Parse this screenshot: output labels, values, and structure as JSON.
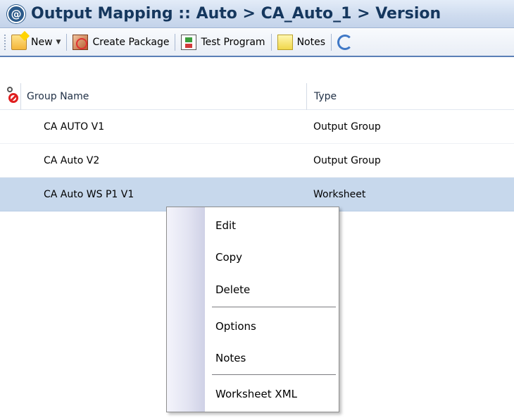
{
  "window": {
    "title": "Output Mapping :: Auto > CA_Auto_1 > Version",
    "title_icon": "circle-at-icon"
  },
  "toolbar": {
    "new_label": "New",
    "create_package_label": "Create Package",
    "test_program_label": "Test Program",
    "notes_label": "Notes"
  },
  "grid": {
    "columns": [
      "Group Name",
      "Type"
    ],
    "rows": [
      {
        "name": "CA AUTO V1",
        "type": "Output Group"
      },
      {
        "name": "CA Auto V2",
        "type": "Output Group"
      },
      {
        "name": "CA Auto WS P1 V1",
        "type": "Worksheet"
      }
    ],
    "selected_index": 2
  },
  "context_menu": {
    "items": [
      "Edit",
      "Copy",
      "Delete",
      "Options",
      "Notes",
      "Worksheet XML"
    ]
  }
}
